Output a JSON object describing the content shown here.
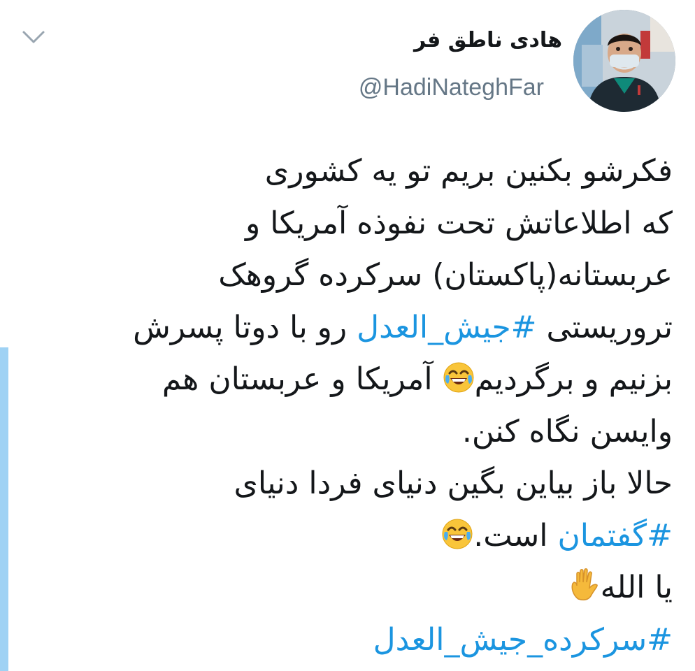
{
  "header": {
    "display_name": "هادی ناطق فر",
    "handle": "@HadiNateghFar",
    "menu_icon": "chevron-down-icon",
    "avatar_icon": "profile-photo"
  },
  "tweet": {
    "line1": "فکرشو بکنین بریم تو یه کشوری",
    "line2": "که اطلاعاتش تحت نفوذه آمریکا و",
    "line3": "عربستانه(پاکستان) سرکرده گروهک",
    "line4_before": "تروریستی ",
    "line4_hashtag": "#جیش_العدل",
    "line4_after": " رو با دوتا پسرش",
    "line5_before": "بزنیم و برگردیم",
    "line5_after": " آمریکا و عربستان هم",
    "line6": "وایسن نگاه کنن.",
    "line7": "حالا باز بیاین بگین دنیای فردا دنیای",
    "line8_hashtag": "#گفتمان",
    "line8_after": " است.",
    "line9": "یا الله",
    "line10_hashtag": "#سرکرده_جیش_العدل",
    "emoji_laugh": "face-with-tears-of-joy",
    "emoji_hand": "raised-hand"
  },
  "colors": {
    "hashtag": "#1b95e0",
    "handle": "#657786",
    "text": "#14171a",
    "accent_bar": "#9fd2f4"
  }
}
